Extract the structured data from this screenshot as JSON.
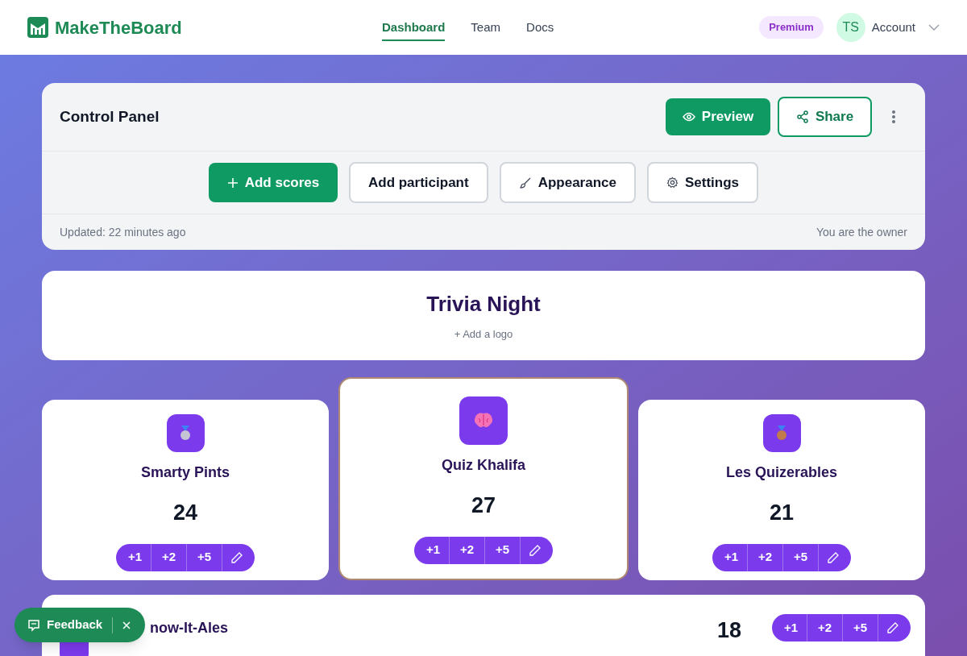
{
  "brand": {
    "name": "MakeTheBoard"
  },
  "nav": [
    {
      "label": "Dashboard",
      "selected": true
    },
    {
      "label": "Team",
      "selected": false
    },
    {
      "label": "Docs",
      "selected": false
    }
  ],
  "account": {
    "plan": "Premium",
    "initials": "TS",
    "label": "Account"
  },
  "control_panel": {
    "title": "Control Panel",
    "preview": "Preview",
    "share": "Share",
    "actions": [
      {
        "kind": "primary",
        "label": "Add scores"
      },
      {
        "kind": "outline",
        "label": "Add participant"
      },
      {
        "kind": "outline",
        "label": "Appearance"
      },
      {
        "kind": "outline",
        "label": "Settings"
      }
    ],
    "updated": "Updated: 22 minutes ago",
    "owner": "You are the owner"
  },
  "board": {
    "title": "Trivia Night",
    "add_logo": "+ Add a logo"
  },
  "participants": [
    {
      "kind": "second",
      "name": "Smarty Pints",
      "score": "24",
      "increments": [
        "+1",
        "+2",
        "+5"
      ]
    },
    {
      "kind": "first",
      "name": "Quiz Khalifa",
      "score": "27",
      "increments": [
        "+1",
        "+2",
        "+5"
      ]
    },
    {
      "kind": "third",
      "name": "Les Quizerables",
      "score": "21",
      "increments": [
        "+1",
        "+2",
        "+5"
      ]
    },
    {
      "kind": "row",
      "name": "now-It-Ales",
      "score": "18",
      "increments": [
        "+1",
        "+2",
        "+5"
      ]
    }
  ],
  "feedback": {
    "label": "Feedback"
  }
}
